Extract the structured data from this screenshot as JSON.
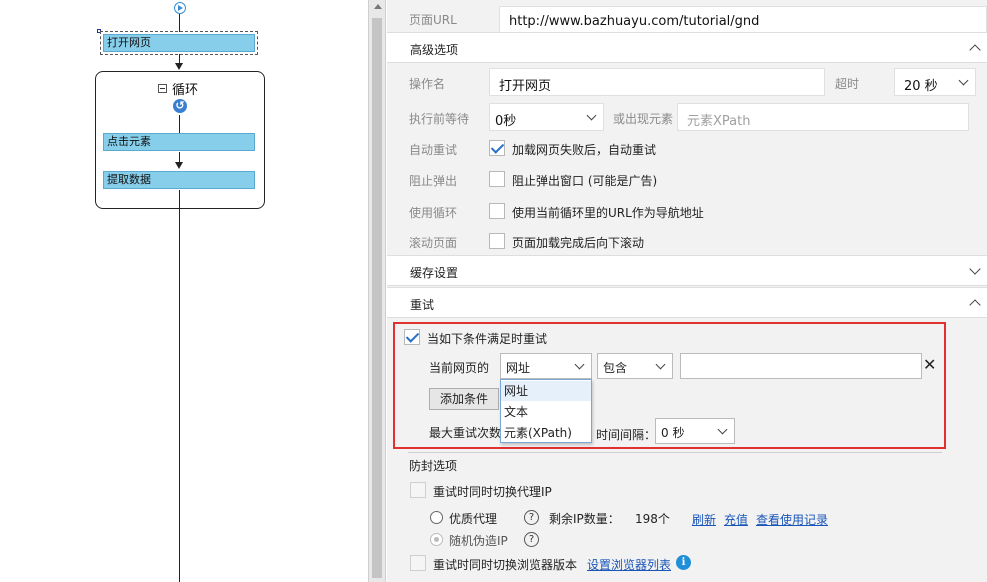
{
  "workflow": {
    "steps": {
      "open_page": "打开网页",
      "loop": "循环",
      "click_element": "点击元素",
      "extract_data": "提取数据"
    }
  },
  "props": {
    "page_url": {
      "label": "页面URL",
      "value": "http://www.bazhuayu.com/tutorial/gnd"
    },
    "advanced": {
      "title": "高级选项",
      "op_name_label": "操作名",
      "op_name_value": "打开网页",
      "timeout_label": "超时",
      "timeout_value": "20 秒",
      "wait_label": "执行前等待",
      "wait_value": "0秒",
      "or_appear_label": "或出现元素",
      "xpath_placeholder": "元素XPath",
      "auto_retry_label": "自动重试",
      "auto_retry_text": "加载网页失败后，自动重试",
      "block_popup_label": "阻止弹出",
      "block_popup_text": "阻止弹出窗口 (可能是广告)",
      "use_loop_label": "使用循环",
      "use_loop_text": "使用当前循环里的URL作为导航地址",
      "scroll_label": "滚动页面",
      "scroll_text": "页面加载完成后向下滚动"
    },
    "cache": {
      "title": "缓存设置"
    },
    "retry": {
      "title": "重试",
      "condition_check": "当如下条件满足时重试",
      "current_page_label": "当前网页的",
      "target_value": "网址",
      "operator_value": "包含",
      "condition_value": "",
      "remove": "✕",
      "add_button": "添加条件",
      "max_retry_label": "最大重试次数",
      "interval_label": "时间间隔：",
      "interval_value": "0 秒",
      "dropdown_options": [
        "网址",
        "文本",
        "元素(XPath)"
      ]
    },
    "anti_block": {
      "title": "防封选项",
      "switch_proxy": "重试时同时切换代理IP",
      "quality_proxy": "优质代理",
      "remaining_ip_label": "剩余IP数量：",
      "remaining_ip_value": "198个",
      "refresh": "刷新",
      "recharge": "充值",
      "usage_record": "查看使用记录",
      "random_ip": "随机伪造IP",
      "switch_browser": "重试时同时切换浏览器版本",
      "set_browser_list": "设置浏览器列表"
    }
  },
  "colors": {
    "step_fill": "#87ceeb",
    "highlight_border": "#e03030",
    "link": "#1a55b8",
    "check": "#2a6fc9"
  }
}
